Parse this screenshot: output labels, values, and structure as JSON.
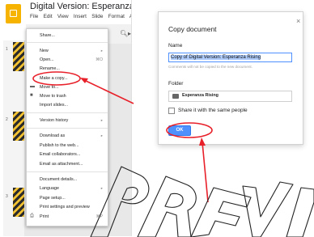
{
  "app": {
    "document_title": "Digital Version: Esperanza Rising",
    "menus": [
      "File",
      "Edit",
      "View",
      "Insert",
      "Slide",
      "Format",
      "A"
    ]
  },
  "thumbnails": [
    "1",
    "2",
    "3"
  ],
  "file_menu": {
    "items": [
      {
        "label": "Share...",
        "shortcut": ""
      },
      {
        "label": "New",
        "shortcut": "▸"
      },
      {
        "label": "Open...",
        "shortcut": "⌘O"
      },
      {
        "label": "Rename...",
        "shortcut": ""
      },
      {
        "label": "Make a copy...",
        "shortcut": ""
      },
      {
        "label": "Move to...",
        "shortcut": ""
      },
      {
        "label": "Move to trash",
        "shortcut": ""
      },
      {
        "label": "Import slides...",
        "shortcut": ""
      },
      {
        "label": "Version history",
        "shortcut": "▸"
      },
      {
        "label": "Download as",
        "shortcut": "▸"
      },
      {
        "label": "Publish to the web...",
        "shortcut": ""
      },
      {
        "label": "Email collaborators...",
        "shortcut": ""
      },
      {
        "label": "Email as attachment...",
        "shortcut": ""
      },
      {
        "label": "Document details...",
        "shortcut": ""
      },
      {
        "label": "Language",
        "shortcut": "▸"
      },
      {
        "label": "Page setup...",
        "shortcut": ""
      },
      {
        "label": "Print settings and preview",
        "shortcut": ""
      },
      {
        "label": "Print",
        "shortcut": "⌘P"
      }
    ]
  },
  "dialog": {
    "title": "Copy document",
    "close": "×",
    "name_label": "Name",
    "name_value": "Copy of Digital Version: Esperanza Rising",
    "hint": "Comments will not be copied to the new document.",
    "folder_label": "Folder",
    "folder_name": "Esperanza Rising",
    "share_label": "Share it with the same people",
    "ok": "OK"
  },
  "colors": {
    "accent": "#4d90fe",
    "annotation": "#e8202a",
    "slides_logo": "#f6b400"
  }
}
